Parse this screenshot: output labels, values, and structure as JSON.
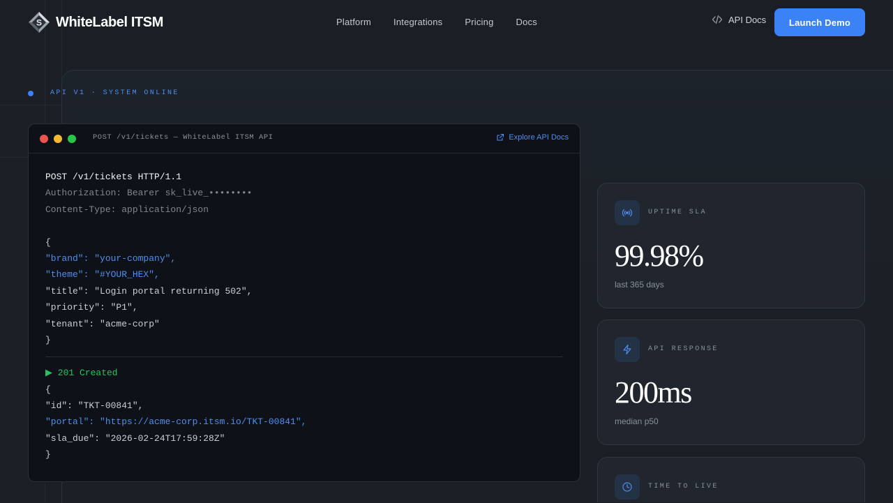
{
  "header": {
    "brand_name": "WhiteLabel ITSM",
    "nav": [
      "Platform",
      "Integrations",
      "Pricing",
      "Docs"
    ],
    "api_docs_label": "API Docs",
    "launch_label": "Launch Demo"
  },
  "status": {
    "text": "API V1 · SYSTEM ONLINE"
  },
  "terminal": {
    "title": "POST /v1/tickets — WhiteLabel ITSM API",
    "explore_label": "Explore API Docs",
    "request_lines": [
      "POST /v1/tickets HTTP/1.1",
      "Authorization: Bearer sk_live_••••••••",
      "Content-Type: application/json",
      "",
      "{",
      "\"brand\": \"your-company\",",
      "\"theme\": \"#YOUR_HEX\",",
      "\"title\": \"Login portal returning 502\",",
      "\"priority\": \"P1\",",
      "\"tenant\": \"acme-corp\"",
      "}"
    ],
    "response_status": "▶ 201 Created",
    "response_lines": [
      "{",
      "\"id\": \"TKT-00841\",",
      "\"portal\": \"https://acme-corp.itsm.io/TKT-00841\",",
      "\"sla_due\": \"2026-02-24T17:59:28Z\"",
      "}"
    ]
  },
  "metrics": [
    {
      "label": "UPTIME SLA",
      "value": "99.98%",
      "sub": "last 365 days",
      "icon": "broadcast-icon"
    },
    {
      "label": "API RESPONSE",
      "value": "200ms",
      "sub": "median p50",
      "icon": "lightning-icon"
    },
    {
      "label": "TIME TO LIVE",
      "value": "",
      "sub": "",
      "icon": "clock-icon"
    }
  ],
  "colors": {
    "accent": "#3b82f6",
    "background": "#1b1f25",
    "terminal_bg": "#0e1117",
    "dot_red": "#ef5350",
    "dot_yellow": "#f5b82e",
    "dot_green": "#27c84a",
    "success": "#22c55e"
  }
}
